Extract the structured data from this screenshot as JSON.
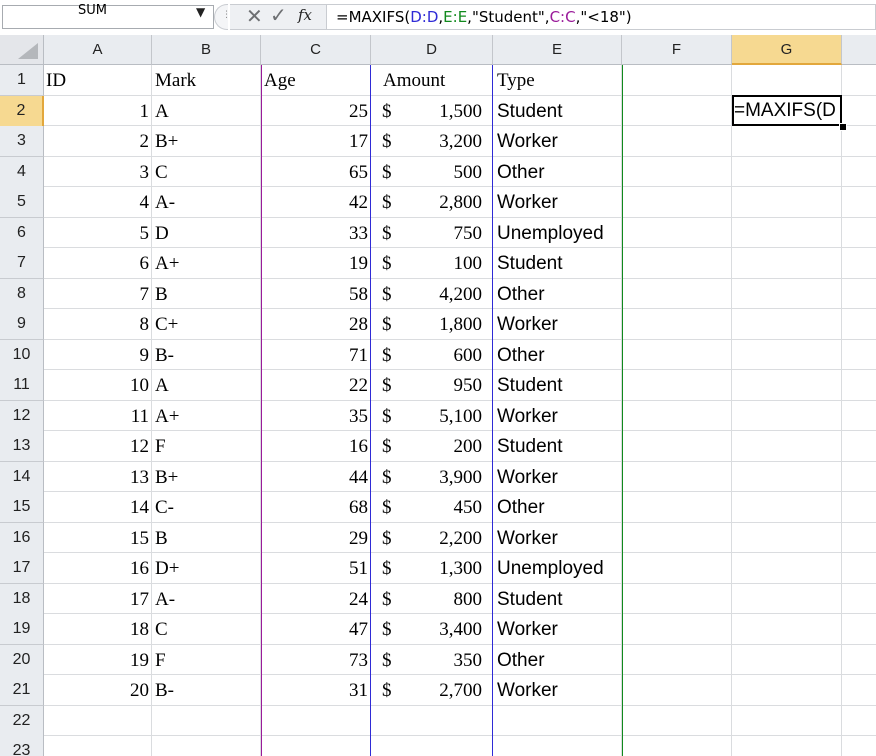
{
  "formula_bar": {
    "name_box": "SUM",
    "formula_parts": [
      {
        "text": "=MAXIFS(",
        "ref": ""
      },
      {
        "text": "D:D",
        "ref": "blue"
      },
      {
        "text": ",",
        "ref": ""
      },
      {
        "text": "E:E",
        "ref": "green"
      },
      {
        "text": ",\"Student\",",
        "ref": ""
      },
      {
        "text": "C:C",
        "ref": "purple"
      },
      {
        "text": ",\"<18\")",
        "ref": ""
      }
    ]
  },
  "colors": {
    "ref_blue": "#2f2bd6",
    "ref_green": "#118a1d",
    "ref_purple": "#9a1b9a",
    "active_header": "#f6d991"
  },
  "icons": {
    "name_box_dropdown": "chevron-down-icon",
    "cancel": "close-icon",
    "enter": "checkmark-icon",
    "insert_function": "fx-icon"
  },
  "columns": [
    "A",
    "B",
    "C",
    "D",
    "E",
    "F",
    "G"
  ],
  "active_column": "G",
  "active_row": 2,
  "row_numbers": [
    "1",
    "2",
    "3",
    "4",
    "5",
    "6",
    "7",
    "8",
    "9",
    "10",
    "11",
    "12",
    "13",
    "14",
    "15",
    "16",
    "17",
    "18",
    "19",
    "20",
    "21",
    "22",
    "23"
  ],
  "headers": {
    "A": "ID",
    "B": "Mark",
    "C": "Age",
    "D": "Amount",
    "E": "Type"
  },
  "currency_symbol": "$",
  "rows": [
    {
      "id": "1",
      "mark": "A",
      "age": "25",
      "amount": "1,500",
      "type": "Student"
    },
    {
      "id": "2",
      "mark": "B+",
      "age": "17",
      "amount": "3,200",
      "type": "Worker"
    },
    {
      "id": "3",
      "mark": "C",
      "age": "65",
      "amount": "500",
      "type": "Other"
    },
    {
      "id": "4",
      "mark": "A-",
      "age": "42",
      "amount": "2,800",
      "type": "Worker"
    },
    {
      "id": "5",
      "mark": "D",
      "age": "33",
      "amount": "750",
      "type": "Unemployed"
    },
    {
      "id": "6",
      "mark": "A+",
      "age": "19",
      "amount": "100",
      "type": "Student"
    },
    {
      "id": "7",
      "mark": "B",
      "age": "58",
      "amount": "4,200",
      "type": "Other"
    },
    {
      "id": "8",
      "mark": "C+",
      "age": "28",
      "amount": "1,800",
      "type": "Worker"
    },
    {
      "id": "9",
      "mark": "B-",
      "age": "71",
      "amount": "600",
      "type": "Other"
    },
    {
      "id": "10",
      "mark": "A",
      "age": "22",
      "amount": "950",
      "type": "Student"
    },
    {
      "id": "11",
      "mark": "A+",
      "age": "35",
      "amount": "5,100",
      "type": "Worker"
    },
    {
      "id": "12",
      "mark": "F",
      "age": "16",
      "amount": "200",
      "type": "Student"
    },
    {
      "id": "13",
      "mark": "B+",
      "age": "44",
      "amount": "3,900",
      "type": "Worker"
    },
    {
      "id": "14",
      "mark": "C-",
      "age": "68",
      "amount": "450",
      "type": "Other"
    },
    {
      "id": "15",
      "mark": "B",
      "age": "29",
      "amount": "2,200",
      "type": "Worker"
    },
    {
      "id": "16",
      "mark": "D+",
      "age": "51",
      "amount": "1,300",
      "type": "Unemployed"
    },
    {
      "id": "17",
      "mark": "A-",
      "age": "24",
      "amount": "800",
      "type": "Student"
    },
    {
      "id": "18",
      "mark": "C",
      "age": "47",
      "amount": "3,400",
      "type": "Worker"
    },
    {
      "id": "19",
      "mark": "F",
      "age": "73",
      "amount": "350",
      "type": "Other"
    },
    {
      "id": "20",
      "mark": "B-",
      "age": "31",
      "amount": "2,700",
      "type": "Worker"
    }
  ],
  "active_cell": {
    "address": "G2",
    "content": "=MAXIFS(D"
  }
}
